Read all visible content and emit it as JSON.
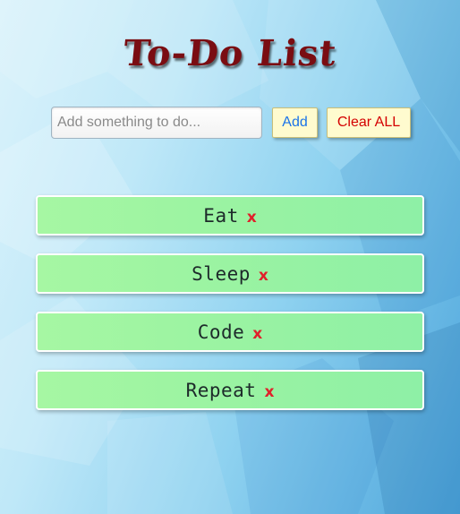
{
  "app": {
    "title": "To-Do List"
  },
  "controls": {
    "input_placeholder": "Add something to do...",
    "input_value": "",
    "add_label": "Add",
    "clear_label": "Clear ALL"
  },
  "todos": [
    {
      "text": "Eat",
      "remove": "x"
    },
    {
      "text": "Sleep",
      "remove": "x"
    },
    {
      "text": "Code",
      "remove": "x"
    },
    {
      "text": "Repeat",
      "remove": "x"
    }
  ],
  "colors": {
    "title": "#7a0d12",
    "item_background": "#9af3a2",
    "remove_x": "#e0202a",
    "add_text": "#1a73e8",
    "clear_text": "#d40000",
    "button_background": "#fffbcf"
  }
}
